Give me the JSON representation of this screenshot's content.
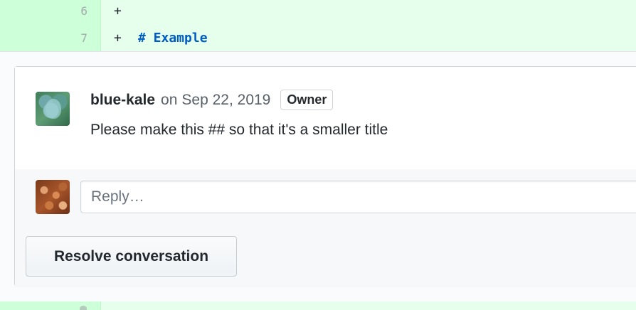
{
  "diff": {
    "lines": [
      {
        "number": "6",
        "marker": "+",
        "content": ""
      },
      {
        "number": "7",
        "marker": "+",
        "content": "# Example"
      }
    ]
  },
  "comment": {
    "author": "blue-kale",
    "on_word": "on",
    "date": "Sep 22, 2019",
    "badge": "Owner",
    "body": "Please make this ## so that it's a smaller title"
  },
  "reply": {
    "placeholder": "Reply…"
  },
  "actions": {
    "resolve_label": "Resolve conversation"
  },
  "colors": {
    "diff_added_gutter": "#cdffd8",
    "diff_added_code": "#e6ffed",
    "heading_blue": "#005cc5"
  }
}
